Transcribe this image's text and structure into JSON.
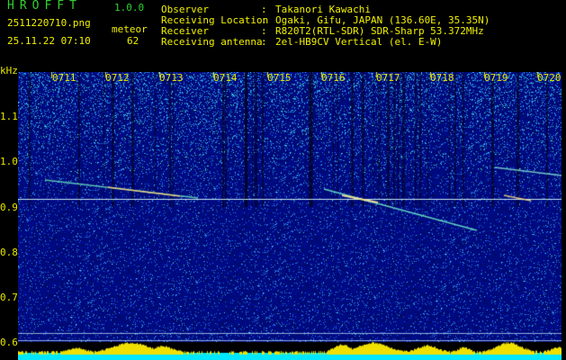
{
  "header": {
    "app_title": "HROFFT",
    "app_version": "1.0.0",
    "file_name": "2511220710.png",
    "date_time": "25.11.22 07:10",
    "detect_label": "meteor",
    "detect_count": "62"
  },
  "info": [
    {
      "label": "Observer",
      "value": "Takanori Kawachi"
    },
    {
      "label": "Receiving Location",
      "value": "Ogaki, Gifu, JAPAN (136.60E, 35.35N)"
    },
    {
      "label": "Receiver",
      "value": "R820T2(RTL-SDR) SDR-Sharp 53.372MHz"
    },
    {
      "label": "Receiving antenna",
      "value": "2el-HB9CV Vertical (el. E-W)"
    }
  ],
  "info_separator": ":",
  "axis": {
    "unit_label": "kHz",
    "y_ticks": [
      "1.1",
      "1.0",
      "0.9",
      "0.8",
      "0.7",
      "0.6"
    ],
    "x_ticks": [
      "0711",
      "0712",
      "0713",
      "0714",
      "0715",
      "0716",
      "0717",
      "0718",
      "0719",
      "0720"
    ]
  },
  "colors": {
    "background": "#000000",
    "spectrogram_base": "#001a8a",
    "header_green": "#2fd12f",
    "header_yellow": "#f0f000",
    "meteor_trace": "#ffe060",
    "carrier_line": "#e8ffff",
    "bottom_bar": "#00e8ff",
    "bottom_peaks": "#f0e000"
  }
}
